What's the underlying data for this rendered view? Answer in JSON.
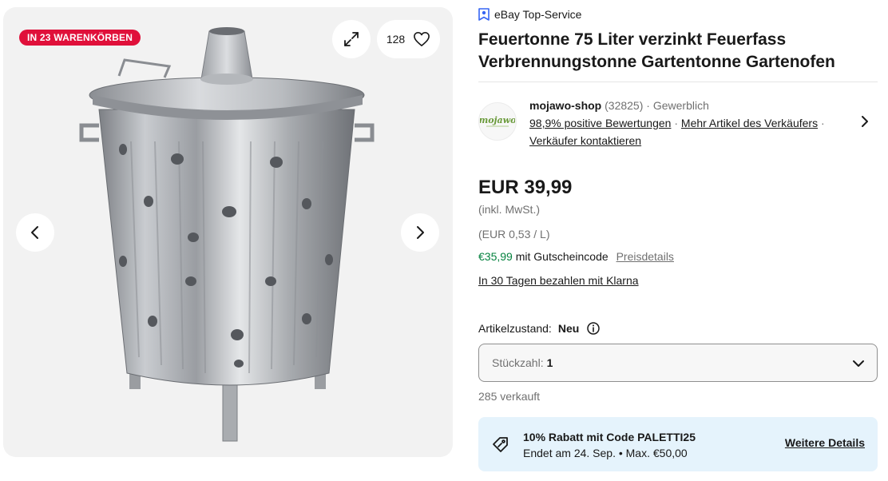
{
  "gallery": {
    "cart_badge": "IN 23 WARENKÖRBEN",
    "watch_count": "128",
    "icons": {
      "expand": "expand-icon",
      "heart": "heart-icon",
      "prev": "chevron-left-icon",
      "next": "chevron-right-icon"
    }
  },
  "listing": {
    "top_service": "eBay Top-Service",
    "title": "Feuertonne 75 Liter verzinkt Feuerfass Verbrennungstonne Gartentonne Gartenofen"
  },
  "seller": {
    "logo_text": "mojawo",
    "name": "mojawo-shop",
    "feedback_count": "(32825)",
    "type": "· Gewerblich",
    "positive": "98,9% positive Bewertungen",
    "more_items": "Mehr Artikel des Verkäufers",
    "separator": "·",
    "contact": "Verkäufer kontaktieren"
  },
  "pricing": {
    "price": "EUR 39,99",
    "vat_note": "(inkl. MwSt.)",
    "unit_price": "(EUR 0,53 / L)",
    "coupon_price": "€35,99",
    "coupon_text": "mit Gutscheincode",
    "price_details": "Preisdetails",
    "klarna": "In 30 Tagen bezahlen mit Klarna"
  },
  "condition": {
    "label": "Artikelzustand:",
    "value": "Neu"
  },
  "quantity": {
    "label": "Stückzahl:",
    "value": "1"
  },
  "sold": "285 verkauft",
  "promo": {
    "title": "10% Rabatt mit Code PALETTI25",
    "subtitle": "Endet am 24. Sep. • Max. €50,00",
    "link": "Weitere Details"
  },
  "colors": {
    "badge_red": "#e0103a",
    "coupon_green": "#05823f",
    "promo_bg": "#e5f3fc",
    "top_service_blue": "#3665f3"
  }
}
